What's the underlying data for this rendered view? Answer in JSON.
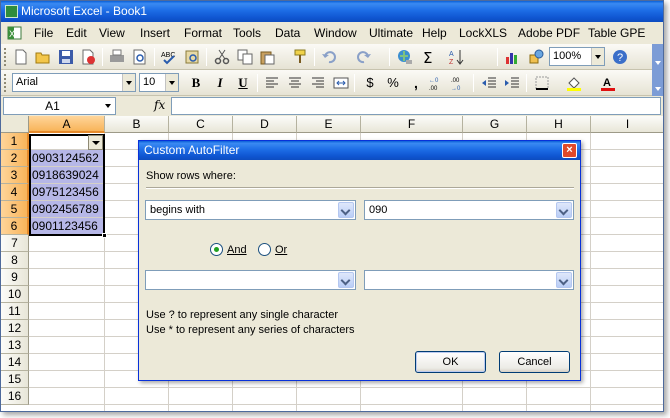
{
  "app": {
    "title": "Microsoft Excel - Book1"
  },
  "menu": [
    "File",
    "Edit",
    "View",
    "Insert",
    "Format",
    "Tools",
    "Data",
    "Window",
    "Ultimate",
    "Help",
    "LockXLS",
    "Adobe PDF",
    "Table GPE"
  ],
  "toolbar_standard": {
    "zoom": "100%",
    "icons": [
      "new-icon",
      "open-icon",
      "save-icon",
      "permission-icon",
      "print-icon",
      "print-preview-icon",
      "spelling-icon",
      "research-icon",
      "cut-icon",
      "copy-icon",
      "paste-icon",
      "format-painter-icon",
      "undo-icon",
      "redo-icon",
      "hyperlink-icon",
      "autosum-icon",
      "sort-ascending-icon",
      "chart-wizard-icon",
      "drawing-icon"
    ]
  },
  "toolbar_formatting": {
    "font_name": "Arial",
    "font_size": "10",
    "bold": "B",
    "italic": "I",
    "underline": "U",
    "currency": "$",
    "percent": "%",
    "comma": ","
  },
  "formula_bar": {
    "name_box": "A1",
    "fx": "fx",
    "formula": ""
  },
  "columns": [
    "A",
    "B",
    "C",
    "D",
    "E",
    "F",
    "G",
    "H",
    "I"
  ],
  "rows": [
    "1",
    "2",
    "3",
    "4",
    "5",
    "6",
    "7",
    "8",
    "9",
    "10",
    "11",
    "12",
    "13",
    "14",
    "15",
    "16"
  ],
  "cells": {
    "A2": "0903124562",
    "A3": "0918639024",
    "A4": "0975123456",
    "A5": "0902456789",
    "A6": "0901123456"
  },
  "dialog": {
    "title": "Custom AutoFilter",
    "show_rows_label": "Show rows where:",
    "condition1": {
      "operator": "begins with",
      "value": "090"
    },
    "logic": {
      "and_label": "And",
      "or_label": "Or",
      "selected": "And"
    },
    "condition2": {
      "operator": "",
      "value": ""
    },
    "hint1": "Use ? to represent any single character",
    "hint2": "Use * to represent any series of characters",
    "ok_label": "OK",
    "cancel_label": "Cancel",
    "close_glyph": "×"
  },
  "colors": {
    "title_blue": "#0f55d1",
    "selection_fill": "#b6b7e7",
    "header_selected": "#f8b45a"
  }
}
